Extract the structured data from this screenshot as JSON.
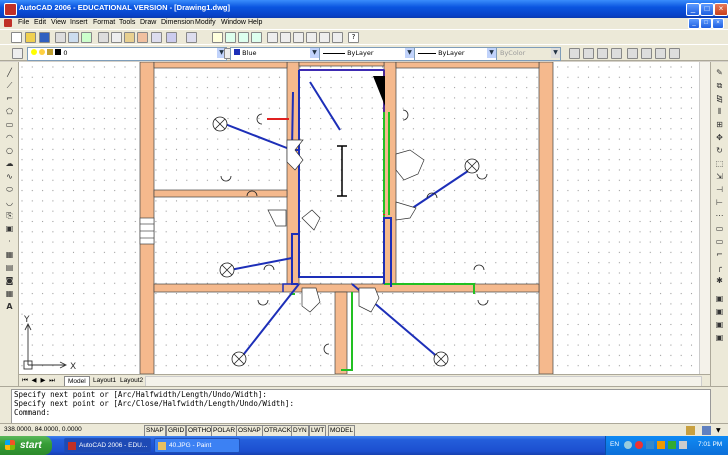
{
  "window": {
    "title": "AutoCAD 2006 - EDUCATIONAL VERSION - [Drawing1.dwg]"
  },
  "menu": {
    "items": [
      "File",
      "Edit",
      "View",
      "Insert",
      "Format",
      "Tools",
      "Draw",
      "Dimension",
      "Modify",
      "Window",
      "Help"
    ]
  },
  "layers": {
    "current": "0"
  },
  "properties": {
    "color": "Blue",
    "linetype": "ByLayer",
    "lineweight": "ByLayer",
    "plotstyle": "ByColor"
  },
  "layout_tabs": [
    "Model",
    "Layout1",
    "Layout2"
  ],
  "ucs": {
    "x_label": "X",
    "y_label": "Y"
  },
  "command": {
    "lines": [
      "Specify next point or [Arc/Halfwidth/Length/Undo/Width]:",
      "Specify next point or [Arc/Close/Halfwidth/Length/Undo/Width]:",
      "Command:"
    ]
  },
  "status": {
    "coords": "338.0000, 84.0000, 0.0000",
    "toggles": [
      "SNAP",
      "GRID",
      "ORTHO",
      "POLAR",
      "OSNAP",
      "OTRACK",
      "DYN",
      "LWT",
      "MODEL"
    ]
  },
  "taskbar": {
    "start": "start",
    "tasks": [
      "AutoCAD 2006 - EDU...",
      "40.JPG - Paint"
    ],
    "language": "EN",
    "time": "7:01 PM"
  },
  "colors": {
    "wall": "#f5b98d",
    "wire_blue": "#1d2fb8",
    "wire_red": "#e02020",
    "wire_green": "#22c022",
    "wire_magenta": "#a020a0"
  }
}
